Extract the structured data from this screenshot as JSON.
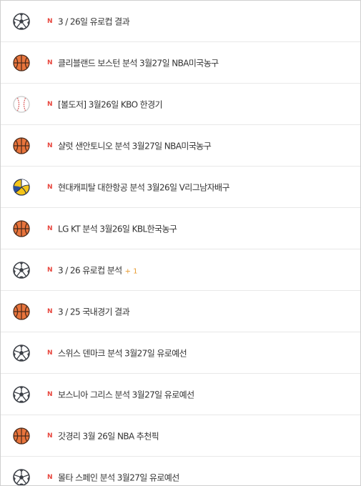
{
  "colors": {
    "new_badge": "#e8453c",
    "comment_count": "#e89b2f",
    "text": "#333333",
    "divider": "#e8e8e8",
    "basketball": "#e8743c"
  },
  "posts": [
    {
      "icon": "soccer-ball-icon",
      "new_label": "N",
      "title": "3 / 26일 유로컵 결과",
      "comment_count": ""
    },
    {
      "icon": "basketball-icon",
      "new_label": "N",
      "title": "클리블랜드 보스턴 분석 3월27일 NBA미국농구",
      "comment_count": ""
    },
    {
      "icon": "baseball-icon",
      "new_label": "N",
      "title": "[볼도저] 3월26일 KBO 한경기",
      "comment_count": ""
    },
    {
      "icon": "basketball-icon",
      "new_label": "N",
      "title": "샬럿 샌안토니오 분석 3월27일 NBA미국농구",
      "comment_count": ""
    },
    {
      "icon": "volleyball-icon",
      "new_label": "N",
      "title": "현대캐피탈 대한항공 분석 3월26일 V리그남자배구",
      "comment_count": ""
    },
    {
      "icon": "basketball-icon",
      "new_label": "N",
      "title": "LG KT 분석 3월26일 KBL한국농구",
      "comment_count": ""
    },
    {
      "icon": "soccer-ball-icon",
      "new_label": "N",
      "title": "3 / 26 유로컵 분석",
      "comment_count": "+ 1"
    },
    {
      "icon": "basketball-icon",
      "new_label": "N",
      "title": "3 / 25 국내경기 결과",
      "comment_count": ""
    },
    {
      "icon": "soccer-ball-icon",
      "new_label": "N",
      "title": "스위스 덴마크 분석 3월27일 유로예선",
      "comment_count": ""
    },
    {
      "icon": "soccer-ball-icon",
      "new_label": "N",
      "title": "보스니아 그리스 분석 3월27일 유로예선",
      "comment_count": ""
    },
    {
      "icon": "basketball-icon",
      "new_label": "N",
      "title": "갓경리 3월 26일 NBA 추천픽",
      "comment_count": ""
    },
    {
      "icon": "soccer-ball-icon",
      "new_label": "N",
      "title": "몰타 스페인 분석 3월27일 유로예선",
      "comment_count": ""
    }
  ]
}
